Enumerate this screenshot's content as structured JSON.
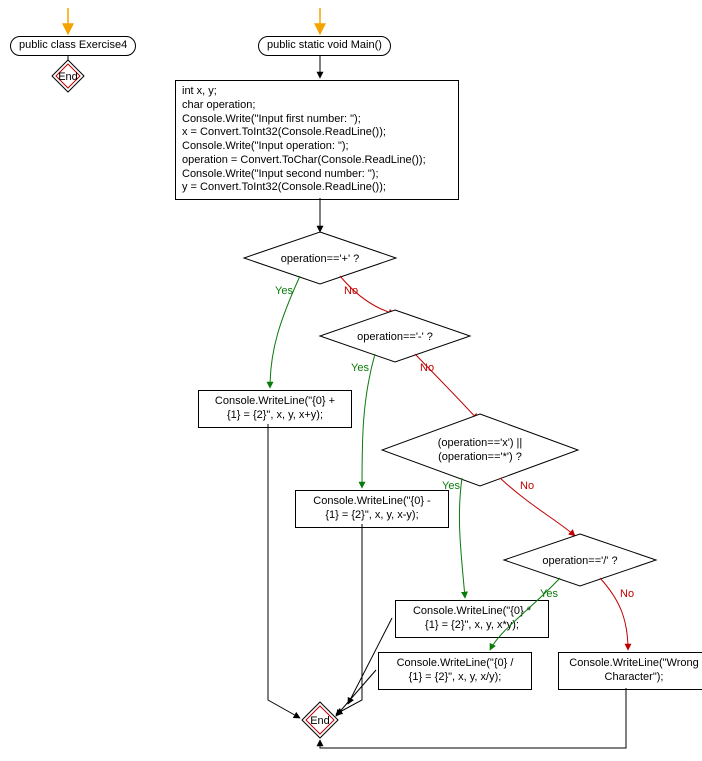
{
  "chart_data": {
    "type": "flowchart",
    "nodes": [
      {
        "id": "class",
        "kind": "rounded",
        "text": "public class Exercise4"
      },
      {
        "id": "endL",
        "kind": "diamond-end",
        "text": "End"
      },
      {
        "id": "main",
        "kind": "rounded",
        "text": "public static void Main()"
      },
      {
        "id": "init",
        "kind": "process",
        "text": "int x, y;\nchar operation;\nConsole.Write(\"Input first number: \");\nx = Convert.ToInt32(Console.ReadLine());\nConsole.Write(\"Input operation: \");\noperation = Convert.ToChar(Console.ReadLine());\nConsole.Write(\"Input second number: \");\ny = Convert.ToInt32(Console.ReadLine());"
      },
      {
        "id": "d_plus",
        "kind": "decision",
        "text": "operation=='+' ?"
      },
      {
        "id": "d_minus",
        "kind": "decision",
        "text": "operation=='-' ?"
      },
      {
        "id": "d_mul",
        "kind": "decision",
        "text": "(operation=='x') ||\n(operation=='*') ?"
      },
      {
        "id": "d_div",
        "kind": "decision",
        "text": "operation=='/' ?"
      },
      {
        "id": "p_plus",
        "kind": "process",
        "text": "Console.WriteLine(\"{0} +\n{1} = {2}\", x, y, x+y);"
      },
      {
        "id": "p_minus",
        "kind": "process",
        "text": "Console.WriteLine(\"{0} -\n{1} = {2}\", x, y, x-y);"
      },
      {
        "id": "p_mul",
        "kind": "process",
        "text": "Console.WriteLine(\"{0} *\n{1} = {2}\", x, y, x*y);"
      },
      {
        "id": "p_div",
        "kind": "process",
        "text": "Console.WriteLine(\"{0} /\n{1} = {2}\", x, y, x/y);"
      },
      {
        "id": "p_wrong",
        "kind": "process",
        "text": "Console.WriteLine(\"Wrong\nCharacter\");"
      },
      {
        "id": "endR",
        "kind": "diamond-end",
        "text": "End"
      }
    ],
    "edges": [
      {
        "from": "entryL",
        "to": "class",
        "style": "orange-arrow"
      },
      {
        "from": "class",
        "to": "endL"
      },
      {
        "from": "entryR",
        "to": "main",
        "style": "orange-arrow"
      },
      {
        "from": "main",
        "to": "init"
      },
      {
        "from": "init",
        "to": "d_plus"
      },
      {
        "from": "d_plus",
        "to": "p_plus",
        "label": "Yes"
      },
      {
        "from": "d_plus",
        "to": "d_minus",
        "label": "No"
      },
      {
        "from": "d_minus",
        "to": "p_minus",
        "label": "Yes"
      },
      {
        "from": "d_minus",
        "to": "d_mul",
        "label": "No"
      },
      {
        "from": "d_mul",
        "to": "p_mul",
        "label": "Yes"
      },
      {
        "from": "d_mul",
        "to": "d_div",
        "label": "No"
      },
      {
        "from": "d_div",
        "to": "p_div",
        "label": "Yes"
      },
      {
        "from": "d_div",
        "to": "p_wrong",
        "label": "No"
      },
      {
        "from": "p_plus",
        "to": "endR"
      },
      {
        "from": "p_minus",
        "to": "endR"
      },
      {
        "from": "p_mul",
        "to": "endR"
      },
      {
        "from": "p_div",
        "to": "endR"
      },
      {
        "from": "p_wrong",
        "to": "endR"
      }
    ]
  },
  "colors": {
    "yes": "#0a7a0a",
    "no": "#c00000",
    "entry_arrow": "#f5a300",
    "end_border": "#c00000"
  }
}
